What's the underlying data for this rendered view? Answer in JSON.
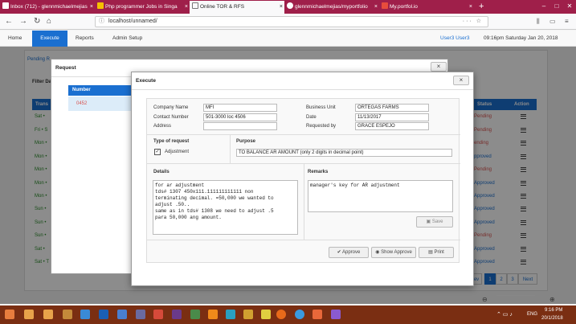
{
  "browser": {
    "tabs": [
      {
        "title": "Inbox (712) - glennmichaelmejias",
        "icon": "gmail-icon"
      },
      {
        "title": "Php programmer Jobs in Singa",
        "icon": "jobsite-icon"
      },
      {
        "title": "Online TOR & RFS",
        "icon": "page-icon"
      },
      {
        "title": "glennmichaelmejias/myportfolio",
        "icon": "github-icon"
      },
      {
        "title": "My.portfol.io",
        "icon": "bookmark-icon"
      }
    ],
    "url": "localhost/unnamed/",
    "url_actions": "···  ☆",
    "new_tab": "+"
  },
  "appnav": {
    "items": [
      "Home",
      "Execute",
      "Reports",
      "Admin Setup"
    ],
    "active": "Execute",
    "user": "User3 User3",
    "clock": "09:16pm  Saturday  Jan 20, 2018"
  },
  "background": {
    "pending_tab": "Pending R",
    "filter_label": "Filter Da",
    "trans_header": "Trans",
    "status_header": "Status",
    "action_header": "Action",
    "rows": [
      {
        "day": "Sat •",
        "status": "Pending"
      },
      {
        "day": "Fri • S",
        "status": "Pending"
      },
      {
        "day": "Mon •",
        "status": "ending"
      },
      {
        "day": "Mon •",
        "status": "pproved"
      },
      {
        "day": "Mon •",
        "status": "Pending"
      },
      {
        "day": "Mon •",
        "status": "Approved"
      },
      {
        "day": "Mon •",
        "status": "Approved"
      },
      {
        "day": "Sun •",
        "status": "Approved"
      },
      {
        "day": "Sun •",
        "status": "Approved"
      },
      {
        "day": "Sun •",
        "status": "Pending"
      },
      {
        "day": "Sat •",
        "status": "Approved"
      },
      {
        "day": "Sat • T",
        "status": "Approved"
      }
    ],
    "pager": [
      "ev",
      "1",
      "2",
      "3",
      "Next"
    ]
  },
  "request_modal": {
    "title": "Request",
    "close": "×",
    "number_header": "Number",
    "number_value": "0452"
  },
  "execute_modal": {
    "title": "Execute",
    "close": "×",
    "company_name_label": "Company Name",
    "company_name": "MFI",
    "contact_label": "Contact Number",
    "contact": "501-3000 loc 4506",
    "address_label": "Address",
    "address": "",
    "business_unit_label": "Business Unit",
    "business_unit": "ORTEGAS FARMS",
    "date_label": "Date",
    "date": "11/13/2017",
    "requested_by_label": "Requested by",
    "requested_by": "GRACE ESPEJO",
    "type_label": "Type of request",
    "type_value": "Adjustment",
    "purpose_label": "Purpose",
    "purpose": "TO BALANCE AR AMOUNT (only 2 digits in decimal point)",
    "details_label": "Details",
    "details": "for ar adjustment\ntds# 1307 450x111.111111111111 non\nterminating decimal. =50,000 we wanted to\nadjust .50..\nsame as in tds# 1308 we need to adjust .5\npara 50,000 ang amount.",
    "remarks_label": "Remarks",
    "remarks": "manager's key for AR adjustment",
    "save": "Save",
    "approve": "Approve",
    "show_approve": "Show Approve",
    "print": "Print"
  },
  "taskbar": {
    "lang": "ENG",
    "time": "9:16 PM",
    "date": "20/1/2018"
  }
}
